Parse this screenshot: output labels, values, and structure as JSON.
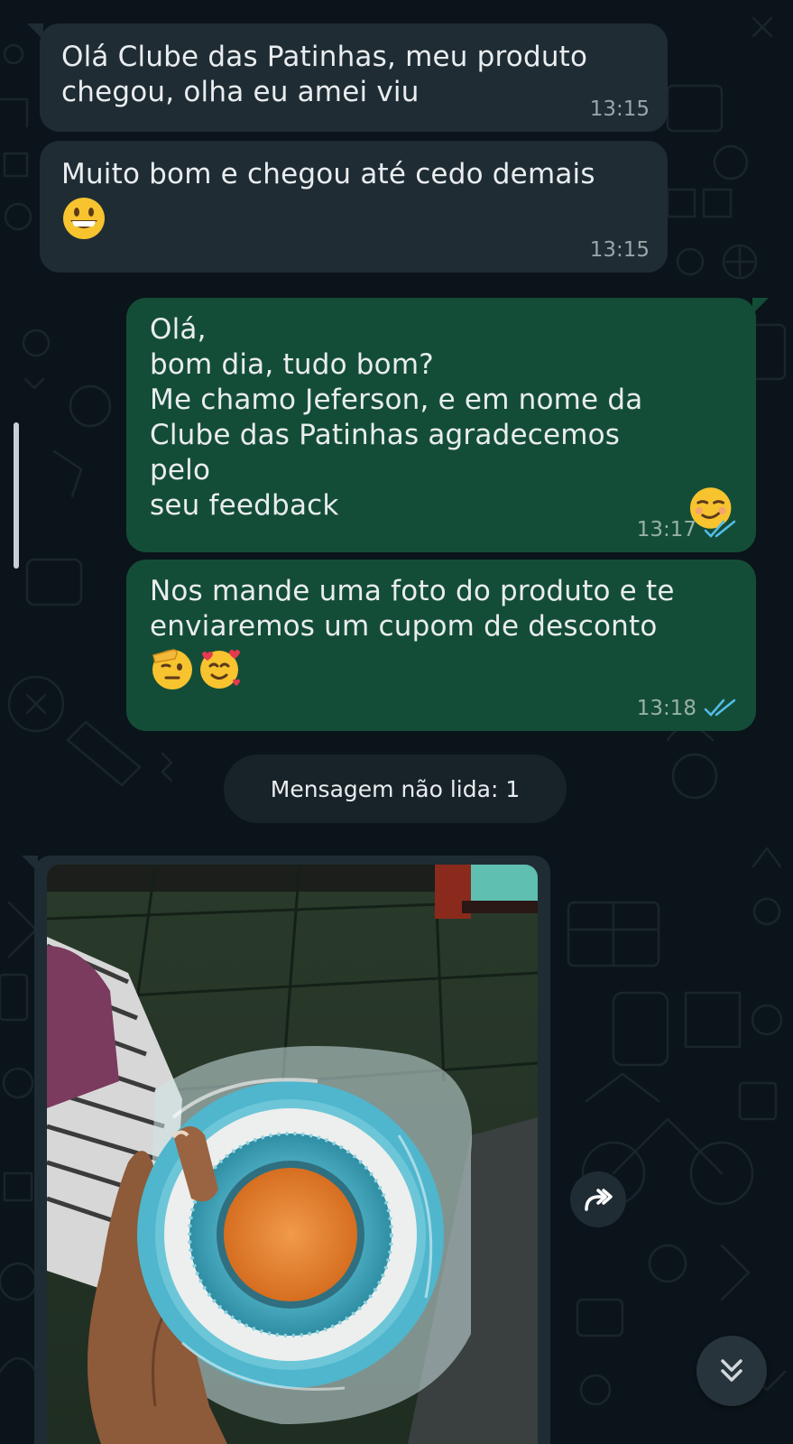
{
  "messages": [
    {
      "id": "msg1",
      "direction": "incoming",
      "text": "Olá Clube das Patinhas, meu produto\nchegou, olha eu amei viu",
      "time": "13:15"
    },
    {
      "id": "msg2",
      "direction": "incoming",
      "text": "Muito bom e chegou até cedo demais",
      "emoji": "grinning-face",
      "time": "13:15"
    },
    {
      "id": "msg3",
      "direction": "outgoing",
      "text": "Olá,\nbom dia, tudo bom?\nMe chamo Jeferson, e em nome da\nClube das Patinhas agradecemos pelo\nseu feedback",
      "emoji": "smirking-face",
      "time": "13:17",
      "status": "read"
    },
    {
      "id": "msg4",
      "direction": "outgoing",
      "text": "Nos mande uma foto do produto e te\nenviaremos um cupom de desconto",
      "emojis": [
        "saluting-face",
        "smiling-face-with-hearts"
      ],
      "time": "13:18",
      "status": "read"
    }
  ],
  "unread_label": "Mensagem não lida: 1",
  "media_message": {
    "direction": "incoming",
    "type": "photo"
  },
  "icons": {
    "forward": "forward-icon",
    "scroll_down": "double-chevron-down-icon",
    "read_receipt": "double-check-icon"
  },
  "colors": {
    "background": "#0b141a",
    "incoming_bubble": "#1f2c33",
    "outgoing_bubble": "#144d37",
    "read_tick": "#53bdeb"
  }
}
